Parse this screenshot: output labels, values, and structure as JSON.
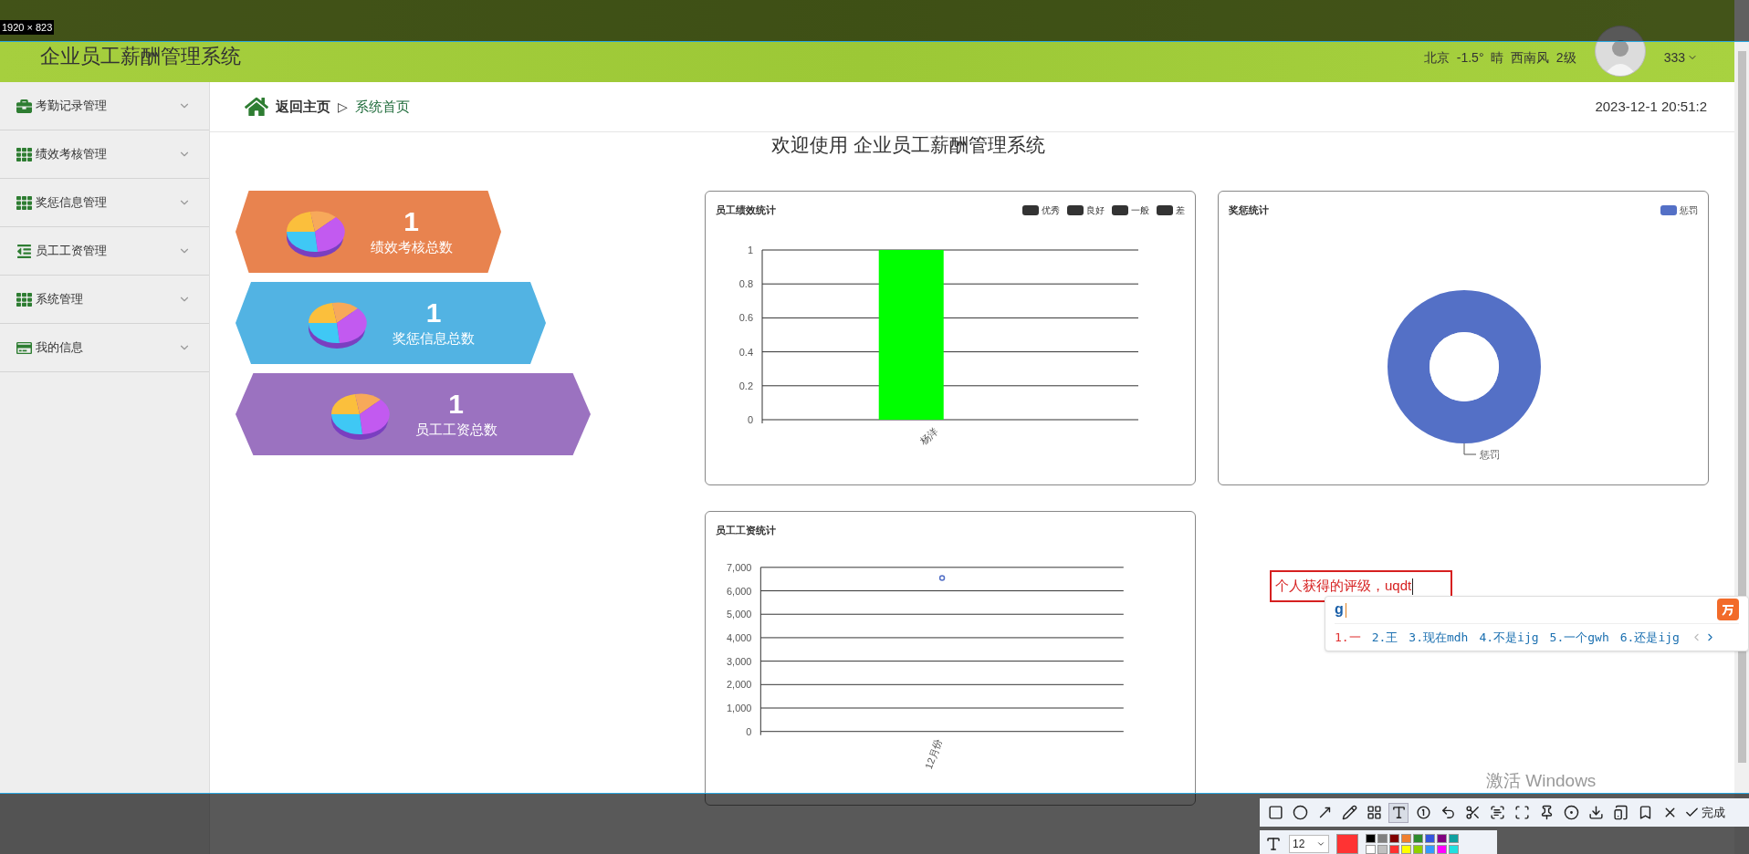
{
  "selection_size": "1920 × 823",
  "header": {
    "title": "企业员工薪酬管理系统",
    "weather": "北京  -1.5°  晴  西南风  2级",
    "user": "333"
  },
  "sidebar": {
    "items": [
      {
        "label": "考勤记录管理",
        "kind": "briefcase"
      },
      {
        "label": "绩效考核管理",
        "kind": "grid"
      },
      {
        "label": "奖惩信息管理",
        "kind": "grid"
      },
      {
        "label": "员工工资管理",
        "kind": "list"
      },
      {
        "label": "系统管理",
        "kind": "grid"
      },
      {
        "label": "我的信息",
        "kind": "card"
      }
    ]
  },
  "breadcrumb": {
    "home": "返回主页",
    "separator": "▷",
    "current": "系统首页",
    "datetime": "2023-12-1 20:51:2"
  },
  "welcome": "欢迎使用 企业员工薪酬管理系统",
  "stats": [
    {
      "value": "1",
      "label": "绩效考核总数",
      "color": "#e8834f"
    },
    {
      "value": "1",
      "label": "奖惩信息总数",
      "color": "#52b3e3"
    },
    {
      "value": "1",
      "label": "员工工资总数",
      "color": "#9b72c0"
    }
  ],
  "charts": [
    {
      "legend": [
        {
          "label": "优秀",
          "color": "#333333"
        },
        {
          "label": "良好",
          "color": "#333333"
        },
        {
          "label": "一般",
          "color": "#333333"
        },
        {
          "label": "差",
          "color": "#333333"
        }
      ],
      "chart_data": {
        "type": "bar",
        "title": "员工绩效统计",
        "grid": true,
        "categories": [
          "杨洋"
        ],
        "series": [
          {
            "color": "#00ff00",
            "values": [
              1
            ]
          }
        ],
        "ylim": [
          0,
          1
        ],
        "yticks": [
          0,
          0.2,
          0.4,
          0.6,
          0.8,
          1
        ]
      }
    },
    {
      "chart_data": {
        "type": "donut",
        "title": "奖惩统计",
        "categories": [
          "惩罚"
        ],
        "series": [
          {
            "name": "惩罚",
            "color": "#5470c6",
            "values": [
              1
            ]
          }
        ]
      }
    },
    {
      "chart_data": {
        "type": "scatter",
        "title": "员工工资统计",
        "grid": true,
        "categories": [
          "12月份"
        ],
        "series": [
          {
            "color": "#5470c6",
            "values": [
              6550
            ]
          }
        ],
        "ylim": [
          0,
          7000
        ],
        "yticks": [
          {
            "value": 0,
            "label": "0"
          },
          {
            "value": 1000,
            "label": "1,000"
          },
          {
            "value": 2000,
            "label": "2,000"
          },
          {
            "value": 3000,
            "label": "3,000"
          },
          {
            "value": 4000,
            "label": "4,000"
          },
          {
            "value": 5000,
            "label": "5,000"
          },
          {
            "value": 6000,
            "label": "6,000"
          },
          {
            "value": 7000,
            "label": "7,000"
          }
        ]
      }
    }
  ],
  "note_input": {
    "value": "个人获得的评级，uqdt"
  },
  "ime": {
    "composition": "g",
    "candidates": [
      {
        "label": "1.一",
        "selected": true
      },
      {
        "label": "2.王",
        "selected": false
      },
      {
        "label": "3.现在mdh",
        "selected": false
      },
      {
        "label": "4.不是ijg",
        "selected": false
      },
      {
        "label": "5.一个gwh",
        "selected": false
      },
      {
        "label": "6.还是ijg",
        "selected": false
      }
    ]
  },
  "os_notice": "激活 Windows",
  "snip_toolbar": {
    "tools": [
      {
        "kind": "rect",
        "selected": false
      },
      {
        "kind": "circle",
        "selected": false
      },
      {
        "kind": "arrow",
        "selected": false
      },
      {
        "kind": "pencil",
        "selected": false
      },
      {
        "kind": "mosaic",
        "selected": false
      },
      {
        "kind": "text",
        "selected": true
      },
      {
        "kind": "number",
        "selected": false
      },
      {
        "kind": "undo",
        "selected": false
      },
      {
        "kind": "scissors",
        "selected": false
      },
      {
        "kind": "ocr",
        "selected": false
      },
      {
        "kind": "scan",
        "selected": false
      },
      {
        "kind": "pin",
        "selected": false
      },
      {
        "kind": "record",
        "selected": false
      },
      {
        "kind": "save",
        "selected": false
      },
      {
        "kind": "phone",
        "selected": false
      },
      {
        "kind": "bookmark",
        "selected": false
      },
      {
        "kind": "close",
        "selected": false
      }
    ],
    "done": "完成",
    "font_size": "12",
    "current_swatch": {
      "color": "#ff3333"
    },
    "palette": [
      {
        "color": "#000000"
      },
      {
        "color": "#808080"
      },
      {
        "color": "#800000"
      },
      {
        "color": "#f08030"
      },
      {
        "color": "#2e8b2e"
      },
      {
        "color": "#3355dd"
      },
      {
        "color": "#800080"
      },
      {
        "color": "#10a0a0"
      },
      {
        "color": "#ffffff"
      },
      {
        "color": "#c0c0c0"
      },
      {
        "color": "#ff3030"
      },
      {
        "color": "#ffff00"
      },
      {
        "color": "#90d000"
      },
      {
        "color": "#3399ff"
      },
      {
        "color": "#ff00ff"
      },
      {
        "color": "#20e0e0"
      }
    ]
  }
}
